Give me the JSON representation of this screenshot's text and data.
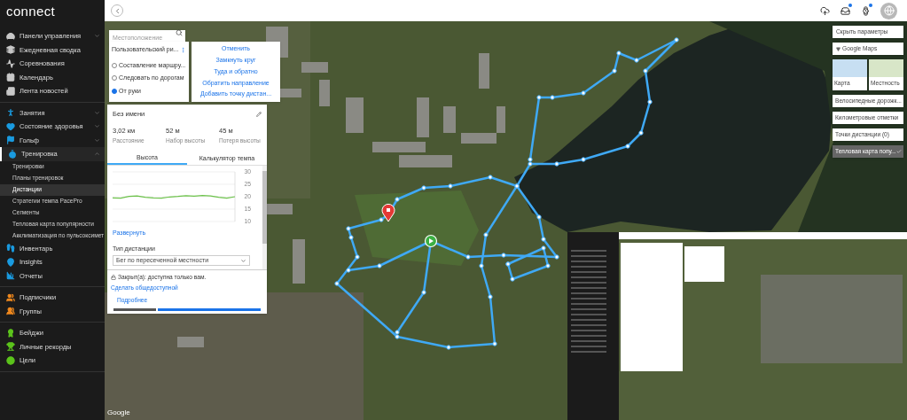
{
  "sidebar": {
    "logo": "connect",
    "groups": [
      {
        "color": "#c8c8c8",
        "items": [
          {
            "label": "Панели управления",
            "expanded": false
          },
          {
            "label": "Ежедневная сводка"
          },
          {
            "label": "Соревнования"
          },
          {
            "label": "Календарь"
          },
          {
            "label": "Лента новостей"
          }
        ]
      },
      {
        "color": "#1a9be0",
        "items": [
          {
            "label": "Занятия",
            "expanded": false
          },
          {
            "label": "Состояние здоровья",
            "expanded": false
          },
          {
            "label": "Гольф",
            "expanded": false
          },
          {
            "label": "Тренировка",
            "expanded": true,
            "children": [
              {
                "label": "Тренировки",
                "selected": false
              },
              {
                "label": "Планы тренировок",
                "selected": false
              },
              {
                "label": "Дистанции",
                "selected": true
              },
              {
                "label": "Стратегии темпа PacePro",
                "selected": false
              },
              {
                "label": "Сегменты",
                "selected": false
              },
              {
                "label": "Тепловая карта популярности",
                "selected": false
              },
              {
                "label": "Акклиматизация по пульсоксимет",
                "selected": false
              }
            ]
          },
          {
            "label": "Инвентарь"
          },
          {
            "label": "Insights"
          },
          {
            "label": "Отчеты"
          }
        ]
      },
      {
        "color": "#f0891e",
        "items": [
          {
            "label": "Подписчики"
          },
          {
            "label": "Группы"
          }
        ]
      },
      {
        "color": "#5cc41c",
        "items": [
          {
            "label": "Бейджи"
          },
          {
            "label": "Личные рекорды"
          },
          {
            "label": "Цели"
          }
        ]
      }
    ]
  },
  "toolbar": [
    {
      "kind": "upload",
      "badge": false
    },
    {
      "kind": "inbox",
      "badge": true
    },
    {
      "kind": "watch",
      "badge": true
    },
    {
      "kind": "avatar",
      "badge": false
    }
  ],
  "search": {
    "placeholder": "Местоположение"
  },
  "route_mode": {
    "title": "Пользовательский ри...",
    "options": [
      {
        "label": "Составление маршру...",
        "selected": false
      },
      {
        "label": "Следовать по дорогам",
        "selected": false
      },
      {
        "label": "От руки",
        "selected": true
      }
    ]
  },
  "actions": [
    "Отменить",
    "Замкнуть круг",
    "Туда и обратно",
    "Обратить направление",
    "Добавить точку дистан..."
  ],
  "course": {
    "title": "Без имени",
    "stats": [
      {
        "value": "3,02 км",
        "label": "Расстояние"
      },
      {
        "value": "52 м",
        "label": "Набор высоты"
      },
      {
        "value": "45 м",
        "label": "Потеря высоты"
      }
    ],
    "tabs": [
      {
        "label": "Высота",
        "selected": true
      },
      {
        "label": "Калькулятор темпа",
        "selected": false
      }
    ],
    "chart_data": {
      "type": "line",
      "grid": true,
      "ylim": [
        10,
        30
      ],
      "yticks": [
        10,
        15,
        20,
        25,
        30
      ],
      "series": [
        {
          "color": "#6cc24a",
          "values": [
            19.5,
            19.4,
            20.1,
            20.3,
            19.8,
            19.5,
            19.4,
            19.9,
            20.1,
            20.4,
            20.2,
            20.5,
            20.3,
            19.8,
            19.4,
            20.0
          ]
        }
      ]
    },
    "expand_link": "Развернуть",
    "type_label": "Тип дистанции",
    "type_value": "Бег по пересеченной местности",
    "privacy_text": "Закрыт(а): доступна только вам.",
    "privacy_link": "Сделать общедоступной",
    "more_link": "Подробнее"
  },
  "map_settings": {
    "hide_button": "Скрыть параметры",
    "provider": "Google Maps",
    "map_types": [
      {
        "label": "Карта",
        "selected": false
      },
      {
        "label": "Местность",
        "selected": false
      }
    ],
    "layers": [
      {
        "label": "Велосипедные дорожк...",
        "checked": false
      },
      {
        "label": "Километровые отметки",
        "checked": false
      },
      {
        "label": "Точки дистанции (0)",
        "checked": false
      },
      {
        "label": "Тепловая карта попу...",
        "checked": true
      }
    ]
  },
  "attribution": "Google"
}
